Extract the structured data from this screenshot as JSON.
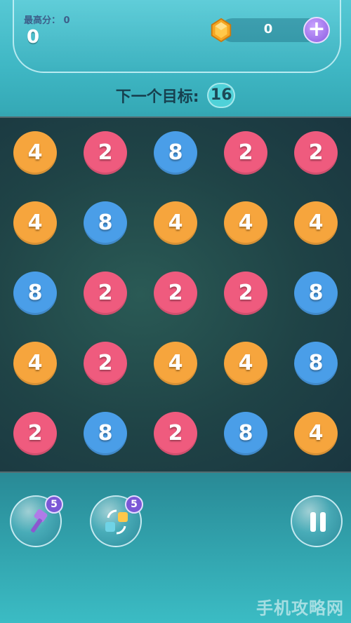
{
  "header": {
    "best_label": "最高分：",
    "best_value": "0",
    "score": "0",
    "gems": "0",
    "plus_symbol": "+"
  },
  "target": {
    "label": "下一个目标:",
    "value": "16"
  },
  "board": {
    "rows": [
      [
        "4",
        "2",
        "8",
        "2",
        "2"
      ],
      [
        "4",
        "8",
        "4",
        "4",
        "4"
      ],
      [
        "8",
        "2",
        "2",
        "2",
        "8"
      ],
      [
        "4",
        "2",
        "4",
        "4",
        "8"
      ],
      [
        "2",
        "8",
        "2",
        "8",
        "4"
      ]
    ],
    "colors": {
      "2": "#ef5b7e",
      "4": "#f6a53d",
      "8": "#4a9ee8"
    }
  },
  "powerups": {
    "hammer_count": "5",
    "swap_count": "5"
  },
  "icons": [
    "gem-icon",
    "plus-icon",
    "hammer-icon",
    "swap-icon",
    "pause-icon"
  ],
  "watermark": "手机攻略网"
}
